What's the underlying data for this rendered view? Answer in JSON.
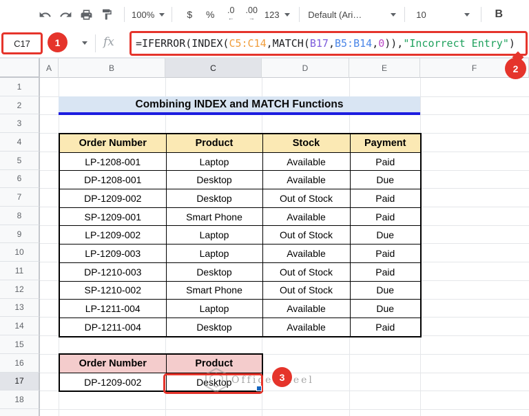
{
  "annotations": {
    "badge1": "1",
    "badge2": "2",
    "badge3": "3",
    "accent_color": "#e5342b"
  },
  "toolbar": {
    "zoom_value": "100%",
    "currency_label": "$",
    "percent_label": "%",
    "decrease_decimal_label": ".0",
    "increase_decimal_label": ".00",
    "more_formats_label": "123",
    "font_value": "Default (Ari…",
    "font_size_value": "10",
    "bold_label": "B"
  },
  "formula_bar": {
    "name_box_value": "C17",
    "fx_label": "fx",
    "formula_segments": [
      {
        "text": "=IFERROR(INDEX(",
        "color": "#202124"
      },
      {
        "text": "C5:C14",
        "color": "#f09d3c"
      },
      {
        "text": ",MATCH(",
        "color": "#202124"
      },
      {
        "text": "B17",
        "color": "#7c5cdb"
      },
      {
        "text": ",",
        "color": "#202124"
      },
      {
        "text": "B5:B14",
        "color": "#4a86e8"
      },
      {
        "text": ",",
        "color": "#202124"
      },
      {
        "text": "0",
        "color": "#bb4ac7"
      },
      {
        "text": ")),",
        "color": "#202124"
      },
      {
        "text": "\"Incorrect Entry\"",
        "color": "#1fa15d"
      },
      {
        "text": ")",
        "color": "#202124"
      }
    ]
  },
  "sheet": {
    "column_letters": [
      "A",
      "B",
      "C",
      "D",
      "E",
      "F"
    ],
    "selected_column": "C",
    "row_numbers": [
      "1",
      "2",
      "3",
      "4",
      "5",
      "6",
      "7",
      "8",
      "9",
      "10",
      "11",
      "12",
      "13",
      "14",
      "15",
      "16",
      "17",
      "18"
    ],
    "selected_row": "17",
    "title": {
      "text": "Combining INDEX and MATCH Functions",
      "bg": "#d9e5f3",
      "underline_color": "#1d1de0"
    },
    "main_table": {
      "header_bg": "#fbe9b4",
      "headers": [
        "Order Number",
        "Product",
        "Stock",
        "Payment"
      ],
      "rows": [
        [
          "LP-1208-001",
          "Laptop",
          "Available",
          "Paid"
        ],
        [
          "DP-1208-001",
          "Desktop",
          "Available",
          "Due"
        ],
        [
          "DP-1209-002",
          "Desktop",
          "Out of Stock",
          "Paid"
        ],
        [
          "SP-1209-001",
          "Smart Phone",
          "Available",
          "Paid"
        ],
        [
          "LP-1209-002",
          "Laptop",
          "Out of Stock",
          "Due"
        ],
        [
          "LP-1209-003",
          "Laptop",
          "Available",
          "Paid"
        ],
        [
          "DP-1210-003",
          "Desktop",
          "Out of Stock",
          "Paid"
        ],
        [
          "SP-1210-002",
          "Smart Phone",
          "Out of Stock",
          "Due"
        ],
        [
          "LP-1211-004",
          "Laptop",
          "Available",
          "Due"
        ],
        [
          "DP-1211-004",
          "Desktop",
          "Available",
          "Paid"
        ]
      ]
    },
    "lookup_table": {
      "header_bg": "#f4cccc",
      "headers": [
        "Order Number",
        "Product"
      ],
      "rows": [
        [
          "DP-1209-002",
          "Desktop"
        ]
      ]
    },
    "watermark": "OfficeWheel"
  }
}
